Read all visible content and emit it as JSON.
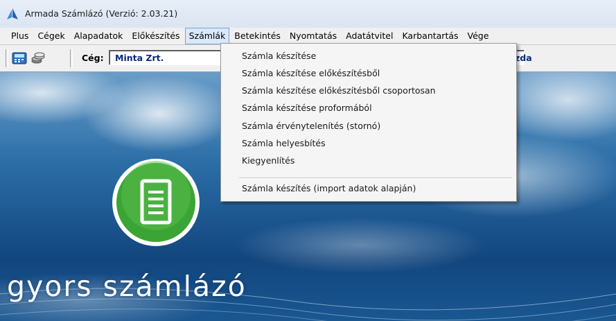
{
  "window": {
    "title": "Armada Számlázó (Verzió: 2.03.21)"
  },
  "menubar": {
    "items": [
      "Plus",
      "Cégek",
      "Alapadatok",
      "Előkészítés",
      "Számlák",
      "Betekintés",
      "Nyomtatás",
      "Adatátvitel",
      "Karbantartás",
      "Vége"
    ],
    "active": "Számlák"
  },
  "toolbar": {
    "ceg_label": "Cég:",
    "ceg_value": "Minta Zrt.",
    "ceg_suffix": "zda"
  },
  "dropdown": {
    "items": [
      "Számla készítése",
      "Számla készítése előkészítésből",
      "Számla készítése előkészítésből csoportosan",
      "Számla készítése proformából",
      "Számla érvénytelenítés (stornó)",
      "Számla helyesbítés",
      "Kiegyenlítés"
    ],
    "after_separator": "Számla készítés (import adatok alapján)"
  },
  "branding": {
    "text": "gyors számlázó"
  },
  "colors": {
    "accent": "#0b2a7a",
    "logo_green": "#3aa535",
    "menu_active": "#d9e8fb"
  }
}
